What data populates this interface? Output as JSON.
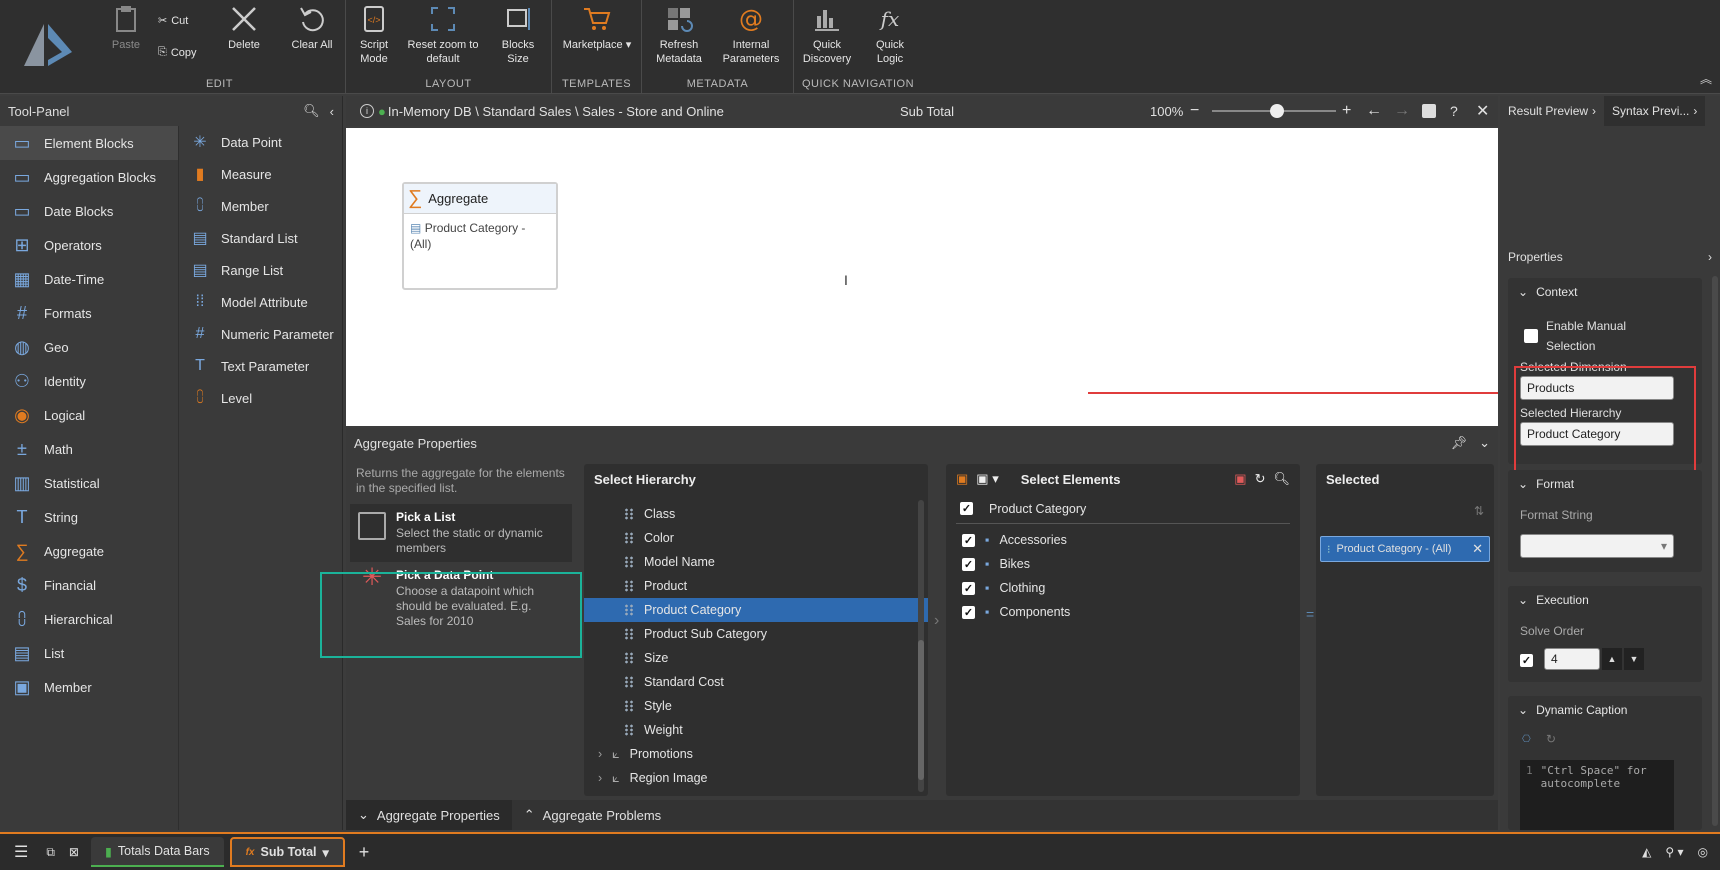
{
  "ribbon": {
    "edit": {
      "title": "EDIT",
      "paste": "Paste",
      "cut": "Cut",
      "copy": "Copy",
      "delete": "Delete",
      "clear_all": "Clear All"
    },
    "layout": {
      "title": "LAYOUT",
      "script_mode": "Script Mode",
      "reset_zoom": "Reset zoom to default",
      "blocks_size": "Blocks Size"
    },
    "templates": {
      "title": "TEMPLATES",
      "marketplace": "Marketplace"
    },
    "metadata": {
      "title": "METADATA",
      "refresh": "Refresh Metadata",
      "internal": "Internal Parameters"
    },
    "quicknav": {
      "title": "QUICK NAVIGATION",
      "discovery": "Quick Discovery",
      "logic": "Quick Logic"
    }
  },
  "toolpanel": {
    "title": "Tool-Panel",
    "categories": [
      {
        "label": "Element Blocks",
        "icon": "element-blocks-icon"
      },
      {
        "label": "Aggregation Blocks",
        "icon": "aggregation-blocks-icon"
      },
      {
        "label": "Date Blocks",
        "icon": "date-blocks-icon"
      },
      {
        "label": "Operators",
        "icon": "operators-icon"
      },
      {
        "label": "Date-Time",
        "icon": "date-time-icon"
      },
      {
        "label": "Formats",
        "icon": "formats-icon"
      },
      {
        "label": "Geo",
        "icon": "geo-icon"
      },
      {
        "label": "Identity",
        "icon": "identity-icon"
      },
      {
        "label": "Logical",
        "icon": "logical-icon"
      },
      {
        "label": "Math",
        "icon": "math-icon"
      },
      {
        "label": "Statistical",
        "icon": "statistical-icon"
      },
      {
        "label": "String",
        "icon": "string-icon"
      },
      {
        "label": "Aggregate",
        "icon": "aggregate-icon"
      },
      {
        "label": "Financial",
        "icon": "financial-icon"
      },
      {
        "label": "Hierarchical",
        "icon": "hierarchical-icon"
      },
      {
        "label": "List",
        "icon": "list-icon"
      },
      {
        "label": "Member",
        "icon": "member-icon"
      }
    ],
    "items": [
      {
        "label": "Data Point"
      },
      {
        "label": "Measure"
      },
      {
        "label": "Member"
      },
      {
        "label": "Standard List"
      },
      {
        "label": "Range List"
      },
      {
        "label": "Model Attribute"
      },
      {
        "label": "Numeric Parameter"
      },
      {
        "label": "Text Parameter"
      },
      {
        "label": "Level"
      }
    ]
  },
  "canvasbar": {
    "breadcrumb": "In-Memory DB \\ Standard Sales \\ Sales - Store and Online",
    "title": "Sub Total",
    "zoom": "100%"
  },
  "canvas": {
    "block_title": "Aggregate",
    "block_body": "Product Category - (All)"
  },
  "rightpanel": {
    "tab_result": "Result Preview",
    "tab_syntax": "Syntax Previ...",
    "properties": "Properties",
    "context": "Context",
    "enable_manual": "Enable Manual Selection",
    "sel_dimension_label": "Selected Dimension",
    "sel_dimension": "Products",
    "sel_hierarchy_label": "Selected Hierarchy",
    "sel_hierarchy": "Product Category",
    "format": "Format",
    "format_string": "Format String",
    "execution": "Execution",
    "solve_order": "Solve Order",
    "solve_value": "4",
    "dynamic_caption": "Dynamic Caption",
    "code_line": "\"Ctrl Space\" for autocomplete",
    "code_ln": "1"
  },
  "aggprops": {
    "title": "Aggregate Properties",
    "desc": "Returns the aggregate for the elements in the specified list.",
    "pick_list_title": "Pick a List",
    "pick_list_desc": "Select the static or dynamic members",
    "pick_dp_title": "Pick a Data Point",
    "pick_dp_desc": "Choose a datapoint which should be evaluated. E.g. Sales for 2010",
    "select_hierarchy": "Select Hierarchy",
    "hierarchies": [
      "Class",
      "Color",
      "Model Name",
      "Product",
      "Product Category",
      "Product Sub Category",
      "Size",
      "Standard Cost",
      "Style",
      "Weight"
    ],
    "folders": [
      "Promotions",
      "Region Image"
    ],
    "select_elements": "Select Elements",
    "elements_header": "Product Category",
    "elements": [
      "Accessories",
      "Bikes",
      "Clothing",
      "Components"
    ],
    "selected": "Selected",
    "selected_chip": "Product Category - (All)"
  },
  "bottomtabs": {
    "props": "Aggregate Properties",
    "problems": "Aggregate Problems"
  },
  "statusbar": {
    "tab1": "Totals Data Bars",
    "tab2": "Sub Total"
  }
}
